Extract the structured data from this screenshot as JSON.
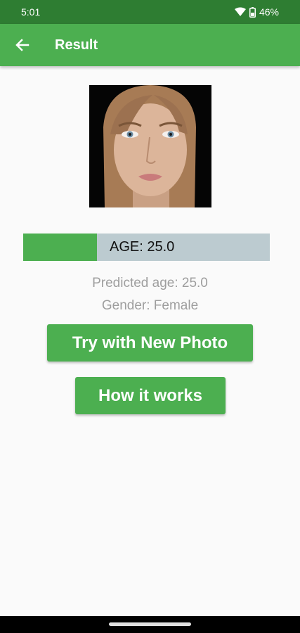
{
  "status_bar": {
    "time": "5:01",
    "battery": "46%"
  },
  "app_bar": {
    "title": "Result",
    "back_icon": "arrow-left-icon"
  },
  "result": {
    "age_bar_label": "AGE: 25.0",
    "age_bar_fill_fraction": 0.3,
    "predicted_age": "Predicted age: 25.0",
    "gender": "Gender: Female"
  },
  "buttons": {
    "try_new_photo": "Try with New Photo",
    "how_it_works": "How it works"
  },
  "colors": {
    "status_bar": "#2e7d32",
    "accent": "#4caf50",
    "progress_track": "#bccbd0",
    "secondary_text": "#9e9e9e"
  }
}
